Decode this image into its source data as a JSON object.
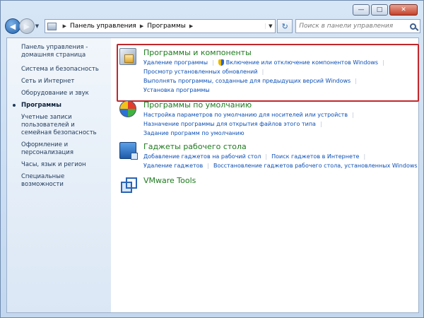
{
  "window": {
    "controls": {
      "minimize": "—",
      "maximize": "□",
      "close": "✕"
    }
  },
  "navigation": {
    "back_icon": "arrow-left-icon",
    "forward_icon": "arrow-right-icon",
    "breadcrumbs": [
      "Панель управления",
      "Программы"
    ],
    "search_placeholder": "Поиск в панели управления"
  },
  "sidebar": {
    "home": "Панель управления - домашняя страница",
    "items": [
      "Система и безопасность",
      "Сеть и Интернет",
      "Оборудование и звук",
      "Программы",
      "Учетные записи пользователей и семейная безопасность",
      "Оформление и персонализация",
      "Часы, язык и регион",
      "Специальные возможности"
    ],
    "active_index": 3
  },
  "groups": [
    {
      "title": "Программы и компоненты",
      "icon": "programs-features-icon",
      "links": [
        "Удаление программы",
        "Включение или отключение компонентов Windows",
        "Просмотр установленных обновлений",
        "Выполнять программы, созданные для предыдущих версий Windows",
        "Установка программы"
      ]
    },
    {
      "title": "Программы по умолчанию",
      "icon": "default-programs-icon",
      "links": [
        "Настройка параметров по умолчанию для носителей или устройств",
        "Назначение программы для открытия файлов этого типа",
        "Задание программ по умолчанию"
      ]
    },
    {
      "title": "Гаджеты рабочего стола",
      "icon": "desktop-gadgets-icon",
      "links": [
        "Добавление гаджетов на рабочий стол",
        "Поиск гаджетов в Интернете",
        "Удаление гаджетов",
        "Восстановление гаджетов рабочего стола, установленных Windows"
      ]
    },
    {
      "title": "VMware Tools",
      "icon": "vmware-tools-icon",
      "links": []
    }
  ],
  "colors": {
    "group_title": "#1e7a1e",
    "link": "#0b4fb4",
    "highlight": "#c0272d"
  }
}
